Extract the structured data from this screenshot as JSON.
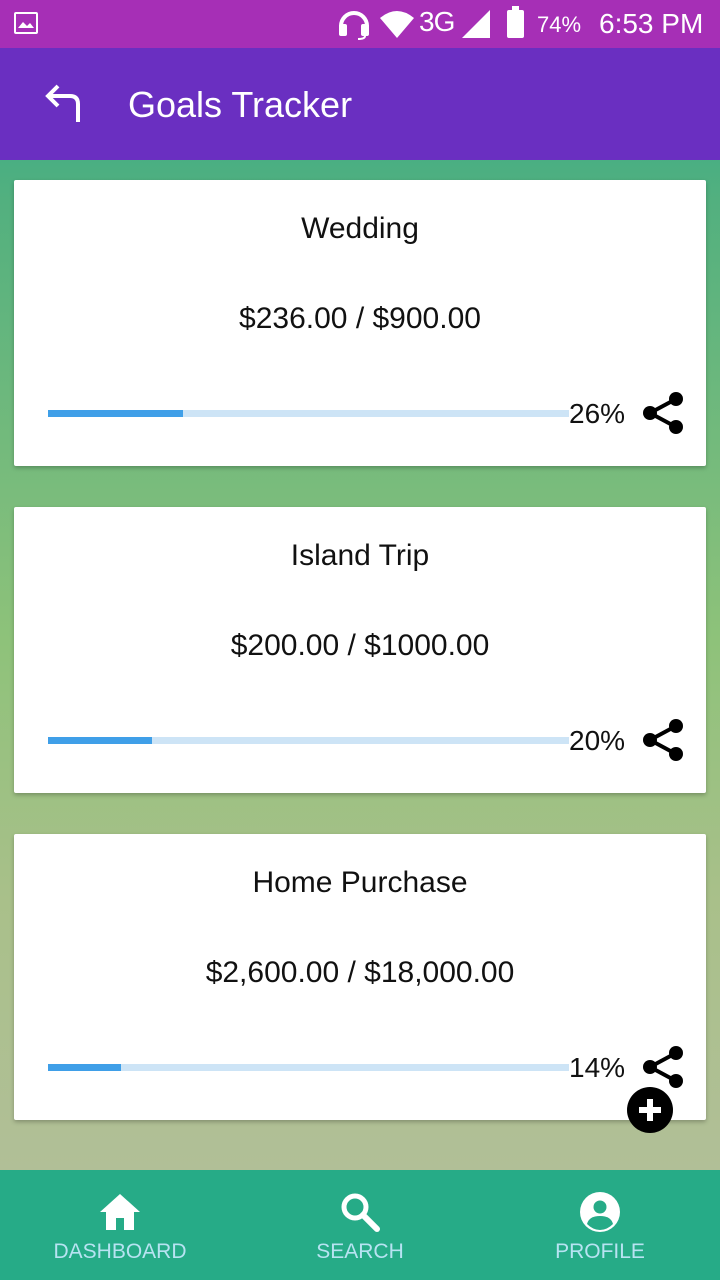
{
  "status_bar": {
    "network": "3G",
    "battery": "74%",
    "time": "6:53 PM",
    "icons": [
      "gallery-icon",
      "headset-icon",
      "wifi-icon",
      "signal-icon",
      "battery-icon"
    ]
  },
  "app_bar": {
    "title": "Goals Tracker",
    "back_icon": "back-arrow-icon"
  },
  "goals": [
    {
      "title": "Wedding",
      "amount": "$236.00 / $900.00",
      "percent": "26%",
      "progress": 0.26
    },
    {
      "title": "Island Trip",
      "amount": "$200.00 / $1000.00",
      "percent": "20%",
      "progress": 0.2
    },
    {
      "title": "Home Purchase",
      "amount": "$2,600.00 / $18,000.00",
      "percent": "14%",
      "progress": 0.14
    }
  ],
  "fab": {
    "icon": "add-icon"
  },
  "bottom_nav": {
    "items": [
      {
        "label": "DASHBOARD",
        "icon": "home-icon"
      },
      {
        "label": "SEARCH",
        "icon": "search-icon"
      },
      {
        "label": "PROFILE",
        "icon": "account-circle-icon"
      }
    ]
  },
  "colors": {
    "status_bar": "#a62fb6",
    "app_bar": "#6a2fc1",
    "bottom_nav": "#26ab87",
    "progress_fill": "#3f9fe8",
    "progress_track": "#cde4f6",
    "nav_label": "#b7e3f2"
  }
}
